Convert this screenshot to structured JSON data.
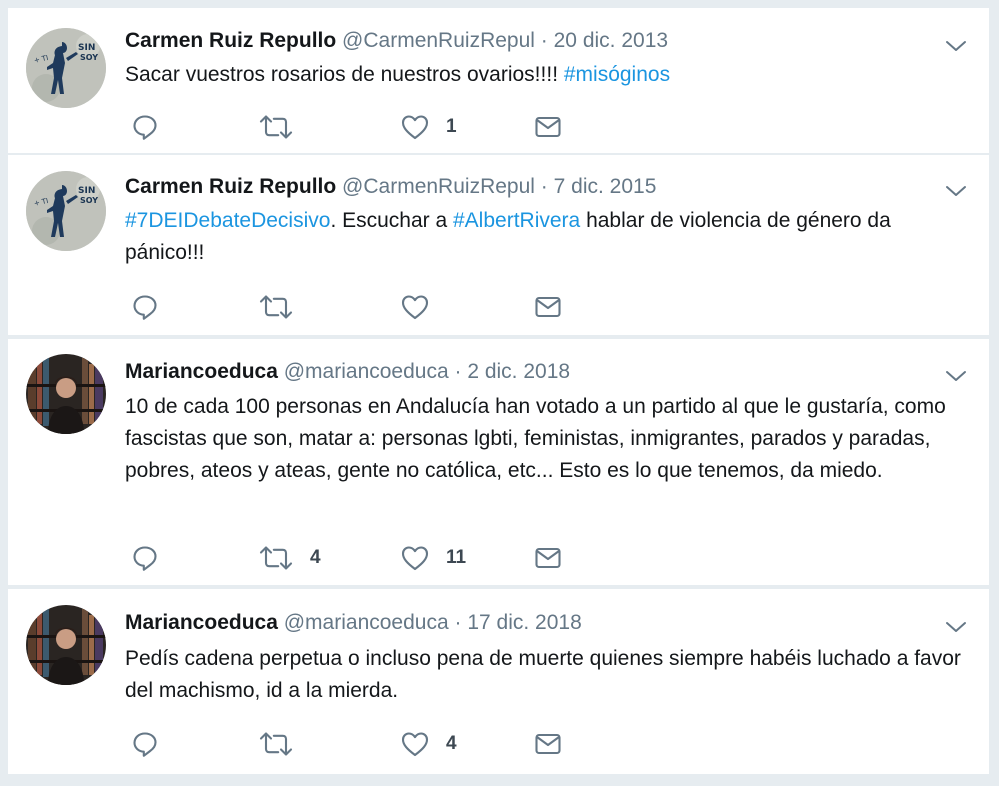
{
  "tweets": [
    {
      "fullname": "Carmen Ruiz Repullo",
      "username": "@CarmenRuizRepul",
      "separator": "·",
      "time": "20 dic. 2013",
      "text_plain": "Sacar vuestros rosarios de nuestros ovarios!!!! ",
      "hashtag": "#misóginos",
      "reply_count": "",
      "retweet_count": "",
      "like_count": "1",
      "avatar": "graffiti-avatar"
    },
    {
      "fullname": "Carmen Ruiz Repullo",
      "username": "@CarmenRuizRepul",
      "separator": "·",
      "time": "7 dic. 2015",
      "hashtag1": "#7DEIDebateDecisivo",
      "text_mid": ". Escuchar a ",
      "hashtag2": "#AlbertRivera",
      "text_end": " hablar de violencia de género da pánico!!!",
      "reply_count": "",
      "retweet_count": "",
      "like_count": "",
      "avatar": "graffiti-avatar"
    },
    {
      "fullname": "Mariancoeduca",
      "username": "@mariancoeduca",
      "separator": "·",
      "time": "2 dic. 2018",
      "text": "10 de cada 100 personas en Andalucía han votado a un partido al que le gustaría, como fascistas que son, matar a: personas lgbti, feministas, inmigrantes, parados y paradas, pobres, ateos y ateas, gente no católica, etc... Esto es lo que tenemos, da miedo.",
      "reply_count": "",
      "retweet_count": "4",
      "like_count": "11",
      "avatar": "library-portrait-avatar"
    },
    {
      "fullname": "Mariancoeduca",
      "username": "@mariancoeduca",
      "separator": "·",
      "time": "17 dic. 2018",
      "text": "Pedís cadena perpetua o incluso pena de muerte quienes siempre habéis luchado a favor del machismo, id a la mierda.",
      "reply_count": "",
      "retweet_count": "",
      "like_count": "4",
      "avatar": "library-portrait-avatar"
    }
  ],
  "colors": {
    "page_background": "#e6ecf0",
    "card_background": "#ffffff",
    "name": "#14171a",
    "meta": "#657786",
    "link": "#1b95e0",
    "icon": "#657786",
    "count": "#3d4852"
  },
  "icons": {
    "reply": "reply-icon",
    "retweet": "retweet-icon",
    "like": "heart-icon",
    "message": "direct-message-icon",
    "menu": "chevron-down-icon"
  }
}
